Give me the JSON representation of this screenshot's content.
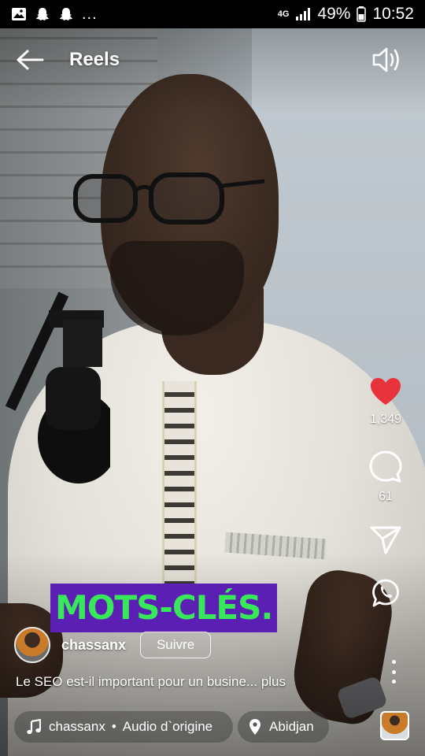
{
  "status_bar": {
    "left_icons": [
      "image-icon",
      "snapchat-icon",
      "snapchat-icon"
    ],
    "overflow": "...",
    "network": "4G",
    "battery": "49%",
    "time": "10:52"
  },
  "header": {
    "title": "Reels",
    "back_icon": "arrow-left-icon",
    "sound_icon": "speaker-icon"
  },
  "video": {
    "caption_overlay": "MOTS-CLÉS.",
    "overlay_colors": {
      "background": "#5b1fb3",
      "text": "#39e85a"
    }
  },
  "actions": {
    "like": {
      "icon": "heart-icon",
      "count": "1,349",
      "color": "#e8333c"
    },
    "comment": {
      "icon": "comment-icon",
      "count": "61"
    },
    "share": {
      "icon": "send-icon"
    },
    "whatsapp": {
      "icon": "whatsapp-icon"
    },
    "more": {
      "icon": "more-vertical-icon"
    }
  },
  "author": {
    "username": "chassanx",
    "follow_label": "Suivre"
  },
  "caption": "Le SEO est-il important pour un busine... plus",
  "audio": {
    "artist": "chassanx",
    "separator": "•",
    "label": "Audio d`origine"
  },
  "location": "Abidjan"
}
